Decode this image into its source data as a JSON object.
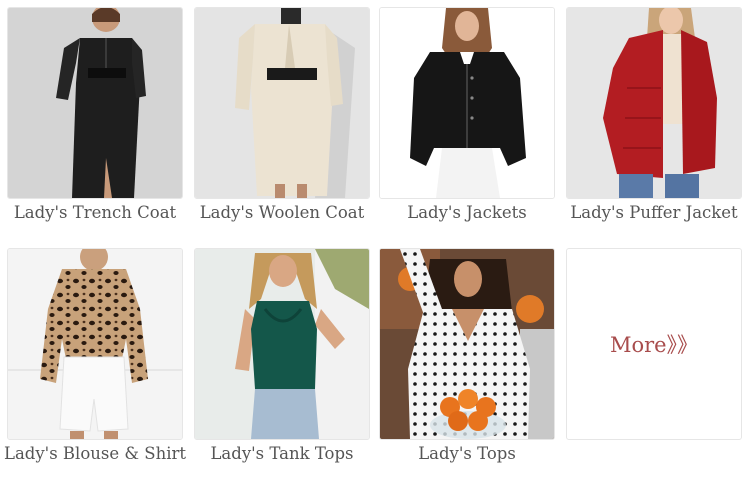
{
  "categories": [
    {
      "label": "Lady's Trench Coat"
    },
    {
      "label": "Lady's Woolen Coat"
    },
    {
      "label": "Lady's Jackets"
    },
    {
      "label": "Lady's Puffer Jacket"
    },
    {
      "label": "Lady's Blouse & Shirt"
    },
    {
      "label": "Lady's Tank Tops"
    },
    {
      "label": "Lady's Tops"
    }
  ],
  "more": {
    "label": "More》》"
  },
  "colors": {
    "border": "#e6e6e6",
    "label_text": "#555555",
    "more_text": "#a84c4c"
  }
}
